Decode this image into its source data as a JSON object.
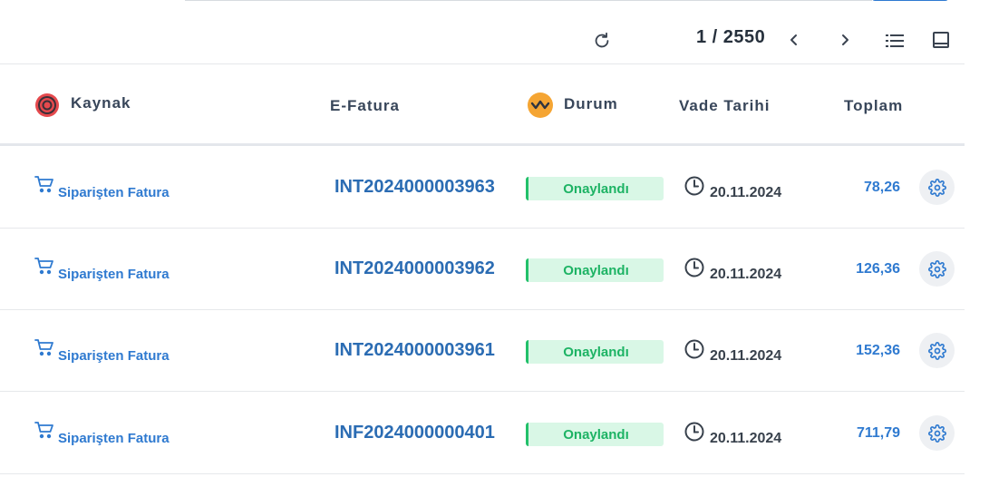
{
  "toolbar": {
    "pager_text": "1 / 2550"
  },
  "columns": {
    "kaynak": "Kaynak",
    "efatura": "E-Fatura",
    "durum": "Durum",
    "vade": "Vade Tarihi",
    "toplam": "Toplam"
  },
  "colors": {
    "accent": "#2f7ad0",
    "status_text": "#1db364",
    "status_bg": "#d9f7e6"
  },
  "rows": [
    {
      "source": "Siparişten Fatura",
      "invoice": "INT2024000003963",
      "status": "Onaylandı",
      "date": "20.11.2024",
      "total": "78,26"
    },
    {
      "source": "Siparişten Fatura",
      "invoice": "INT2024000003962",
      "status": "Onaylandı",
      "date": "20.11.2024",
      "total": "126,36"
    },
    {
      "source": "Siparişten Fatura",
      "invoice": "INT2024000003961",
      "status": "Onaylandı",
      "date": "20.11.2024",
      "total": "152,36"
    },
    {
      "source": "Siparişten Fatura",
      "invoice": "INF2024000000401",
      "status": "Onaylandı",
      "date": "20.11.2024",
      "total": "711,79"
    }
  ]
}
